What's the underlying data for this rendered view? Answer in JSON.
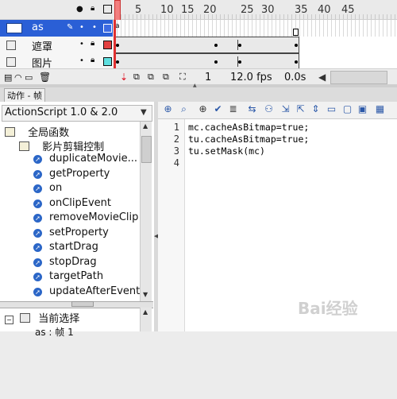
{
  "timeline": {
    "ruler": [
      "5",
      "10",
      "15",
      "20",
      "25",
      "30",
      "35",
      "40",
      "45"
    ],
    "layers": [
      {
        "name": "as"
      },
      {
        "name": "遮罩"
      },
      {
        "name": "图片"
      }
    ],
    "status": {
      "frame": "1",
      "fps": "12.0 fps",
      "time": "0.0s"
    }
  },
  "panel": {
    "tab_label": "动作 - 帧"
  },
  "left_pane": {
    "version_label": "ActionScript 1.0 & 2.0",
    "folder_global": "全局函数",
    "folder_movieclip": "影片剪辑控制",
    "functions": [
      "duplicateMovie...",
      "getProperty",
      "on",
      "onClipEvent",
      "removeMovieClip",
      "setProperty",
      "startDrag",
      "stopDrag",
      "targetPath",
      "updateAfterEvent"
    ],
    "bottom_header": "当前选择",
    "bottom_item": "as : 帧 1"
  },
  "editor": {
    "line_numbers": [
      "1",
      "2",
      "3",
      "4"
    ],
    "lines": [
      "mc.cacheAsBitmap=true;",
      "tu.cacheAsBitmap=true;",
      "tu.setMask(mc)",
      ""
    ]
  },
  "watermark": "Bai经验"
}
